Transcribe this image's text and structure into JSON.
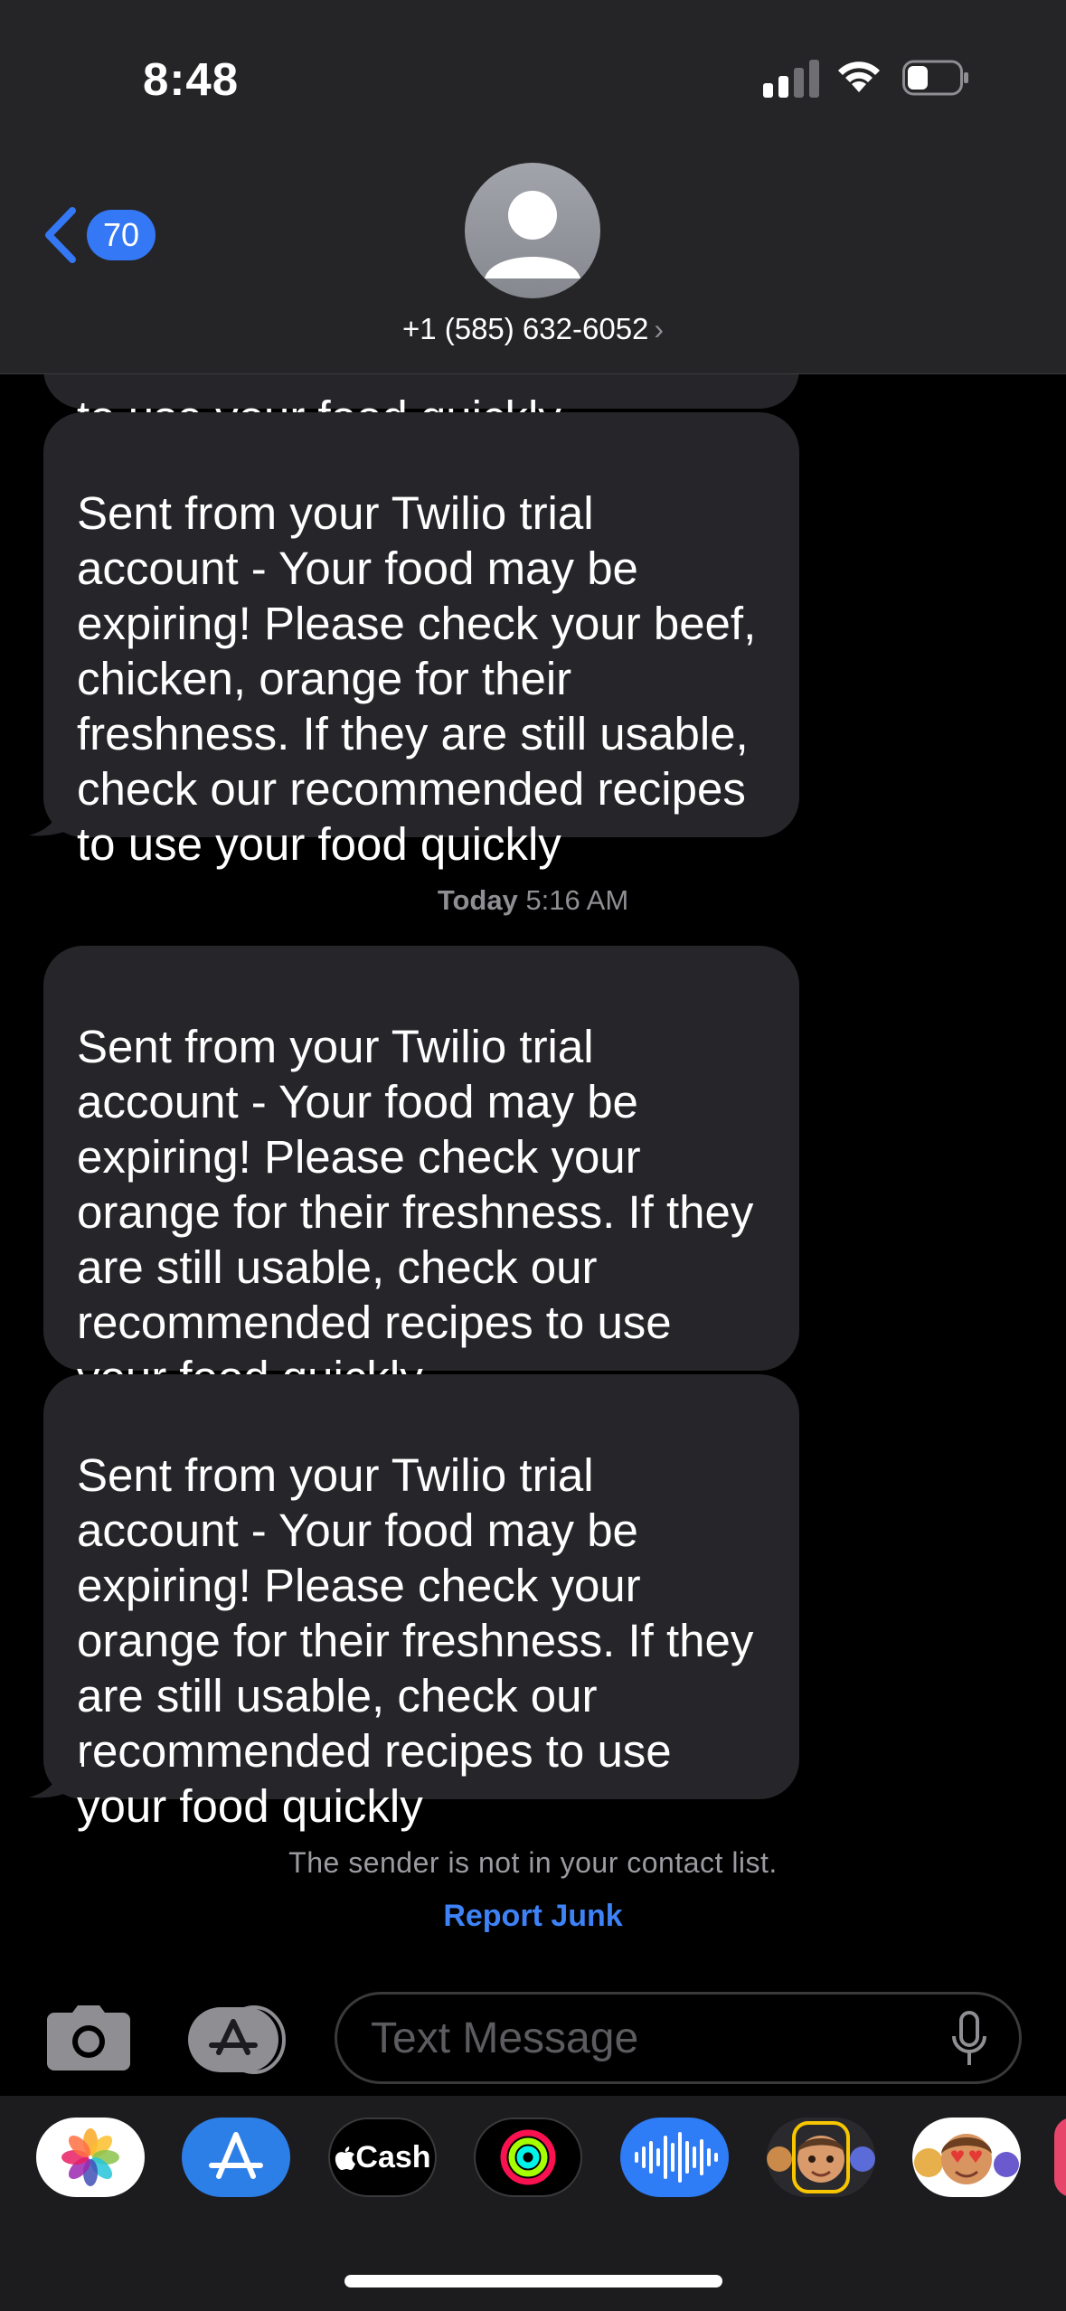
{
  "status_bar": {
    "time": "8:48"
  },
  "header": {
    "back_badge": "70",
    "contact": "+1 (585) 632-6052",
    "contact_chevron": "›"
  },
  "messages": [
    {
      "text": "to use your food quickly"
    },
    {
      "text": "Sent from your Twilio trial\naccount - Your food may be\nexpiring! Please check your beef,\nchicken, orange for their\nfreshness. If they are still usable,\ncheck our recommended recipes\nto use your food quickly"
    },
    {
      "text": "Sent from your Twilio trial\naccount - Your food may be\nexpiring! Please check your\norange for their freshness. If they\nare still usable, check our\nrecommended recipes to use\nyour food quickly"
    },
    {
      "text": "Sent from your Twilio trial\naccount - Your food may be\nexpiring! Please check your\norange for their freshness. If they\nare still usable, check our\nrecommended recipes to use\nyour food quickly"
    }
  ],
  "timestamp": {
    "day": "Today",
    "time": "5:16 AM"
  },
  "notice": "The sender is not in your contact list.",
  "report_junk": "Report Junk",
  "input": {
    "placeholder": "Text Message"
  },
  "apps": {
    "cash_label": "Cash",
    "items": [
      "photos-icon",
      "app-store-icon",
      "apple-cash-icon",
      "fitness-activity-icon",
      "audio-message-icon",
      "memoji-icon",
      "animoji-icon"
    ]
  },
  "colors": {
    "accent": "#3478f6",
    "bubble": "#26262a",
    "header": "#252527"
  }
}
